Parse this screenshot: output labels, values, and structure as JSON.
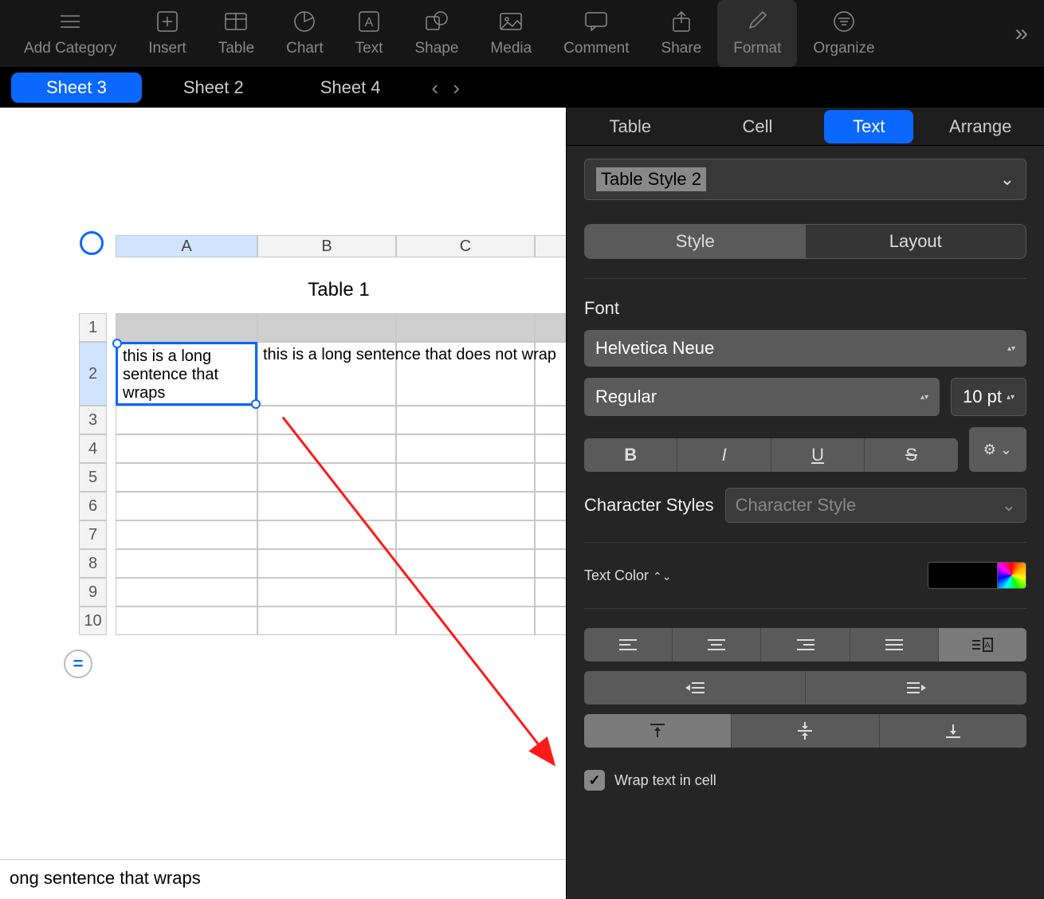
{
  "toolbar": {
    "add_category": "Add Category",
    "insert": "Insert",
    "table": "Table",
    "chart": "Chart",
    "text": "Text",
    "shape": "Shape",
    "media": "Media",
    "comment": "Comment",
    "share": "Share",
    "format": "Format",
    "organize": "Organize"
  },
  "sheets": {
    "tabs": [
      "Sheet 3",
      "Sheet 2",
      "Sheet 4"
    ],
    "active_index": 0
  },
  "table": {
    "title": "Table 1",
    "columns": [
      "A",
      "B",
      "C"
    ],
    "rows": [
      1,
      2,
      3,
      4,
      5,
      6,
      7,
      8,
      9,
      10
    ],
    "cell_A2": "this is a long sentence that wraps",
    "cell_B2": "this is a long sentence that does not wrap"
  },
  "formula_bar": "ong sentence that wraps",
  "inspector": {
    "tabs": [
      "Table",
      "Cell",
      "Text",
      "Arrange"
    ],
    "active_tab_index": 2,
    "table_style": "Table Style 2",
    "segmented": [
      "Style",
      "Layout"
    ],
    "segmented_active": 0,
    "font_section": "Font",
    "font_family": "Helvetica Neue",
    "font_weight": "Regular",
    "font_size": "10 pt",
    "char_styles_label": "Character Styles",
    "char_style_value": "Character Style",
    "text_color_label": "Text Color",
    "wrap_label": "Wrap text in cell",
    "wrap_checked": true
  }
}
